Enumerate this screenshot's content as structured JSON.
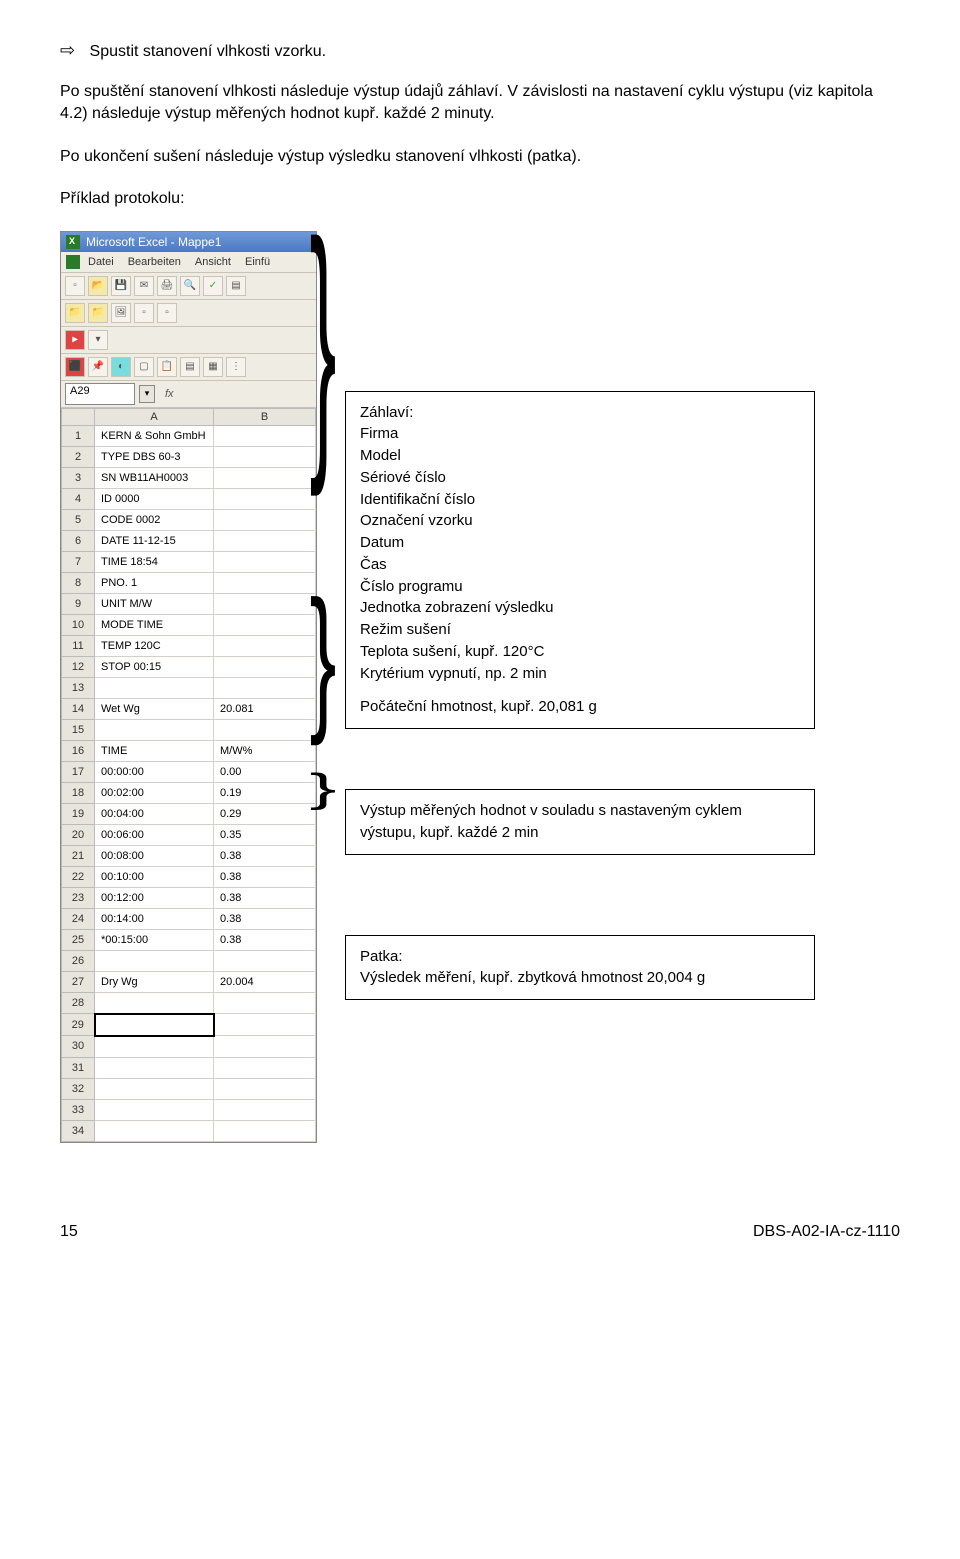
{
  "intro": {
    "line1_arrow": "⇨",
    "line1": "Spustit stanovení vlhkosti vzorku.",
    "p2": "Po spuštění  stanovení vlhkosti následuje výstup údajů záhlaví. V závislosti na nastavení cyklu výstupu (viz kapitola 4.2) následuje výstup měřených hodnot kupř. každé  2 minuty.",
    "p3": "Po ukončení sušení následuje výstup výsledku stanovení vlhkosti  (patka).",
    "p4": "Příklad protokolu:"
  },
  "excel": {
    "title": "Microsoft Excel - Mappe1",
    "menu": {
      "datei": "Datei",
      "bearbeiten": "Bearbeiten",
      "ansicht": "Ansicht",
      "einfu": "Einfü"
    },
    "namebox": "A29",
    "fx": "fx",
    "col_a": "A",
    "col_b": "B",
    "rows": [
      {
        "n": "1",
        "a": "KERN & Sohn GmbH",
        "b": ""
      },
      {
        "n": "2",
        "a": "TYPE DBS 60-3",
        "b": ""
      },
      {
        "n": "3",
        "a": "SN WB11AH0003",
        "b": ""
      },
      {
        "n": "4",
        "a": "ID 0000",
        "b": ""
      },
      {
        "n": "5",
        "a": "CODE 0002",
        "b": ""
      },
      {
        "n": "6",
        "a": "DATE 11-12-15",
        "b": ""
      },
      {
        "n": "7",
        "a": "TIME 18:54",
        "b": ""
      },
      {
        "n": "8",
        "a": "PNO. 1",
        "b": ""
      },
      {
        "n": "9",
        "a": "UNIT M/W",
        "b": ""
      },
      {
        "n": "10",
        "a": "MODE TIME",
        "b": ""
      },
      {
        "n": "11",
        "a": "TEMP 120C",
        "b": ""
      },
      {
        "n": "12",
        "a": "STOP 00:15",
        "b": ""
      },
      {
        "n": "13",
        "a": "",
        "b": ""
      },
      {
        "n": "14",
        "a": "Wet Wg",
        "b": "20.081"
      },
      {
        "n": "15",
        "a": "",
        "b": ""
      },
      {
        "n": "16",
        "a": "TIME",
        "b": "M/W%"
      },
      {
        "n": "17",
        "a": "00:00:00",
        "b": "0.00"
      },
      {
        "n": "18",
        "a": "00:02:00",
        "b": "0.19"
      },
      {
        "n": "19",
        "a": "00:04:00",
        "b": "0.29"
      },
      {
        "n": "20",
        "a": "00:06:00",
        "b": "0.35"
      },
      {
        "n": "21",
        "a": "00:08:00",
        "b": "0.38"
      },
      {
        "n": "22",
        "a": "00:10:00",
        "b": "0.38"
      },
      {
        "n": "23",
        "a": "00:12:00",
        "b": "0.38"
      },
      {
        "n": "24",
        "a": "00:14:00",
        "b": "0.38"
      },
      {
        "n": "25",
        "a": "*00:15:00",
        "b": "0.38"
      },
      {
        "n": "26",
        "a": "",
        "b": ""
      },
      {
        "n": "27",
        "a": "Dry Wg",
        "b": "20.004"
      },
      {
        "n": "28",
        "a": "",
        "b": ""
      },
      {
        "n": "29",
        "a": "",
        "b": ""
      },
      {
        "n": "30",
        "a": "",
        "b": ""
      },
      {
        "n": "31",
        "a": "",
        "b": ""
      },
      {
        "n": "32",
        "a": "",
        "b": ""
      },
      {
        "n": "33",
        "a": "",
        "b": ""
      },
      {
        "n": "34",
        "a": "",
        "b": ""
      }
    ]
  },
  "callout1": {
    "l1": "Záhlaví:",
    "l2": "Firma",
    "l3": "Model",
    "l4": "Sériové číslo",
    "l5": "Identifikační číslo",
    "l6": "Označení vzorku",
    "l7": "Datum",
    "l8": "Čas",
    "l9": "Číslo programu",
    "l10": "Jednotka zobrazení výsledku",
    "l11": "Režim sušení",
    "l12": "Teplota sušení, kupř. 120°C",
    "l13": "Krytérium vypnutí, np. 2 min",
    "l14": "Počáteční hmotnost, kupř. 20,081 g"
  },
  "callout2": {
    "text": "Výstup měřených hodnot v souladu s nastaveným  cyklem výstupu, kupř. každé  2 min"
  },
  "callout3": {
    "l1": "Patka:",
    "l2": "Výsledek měření, kupř. zbytková hmotnost  20,004 g"
  },
  "footer": {
    "left": "15",
    "right": "DBS-A02-IA-cz-1110"
  }
}
